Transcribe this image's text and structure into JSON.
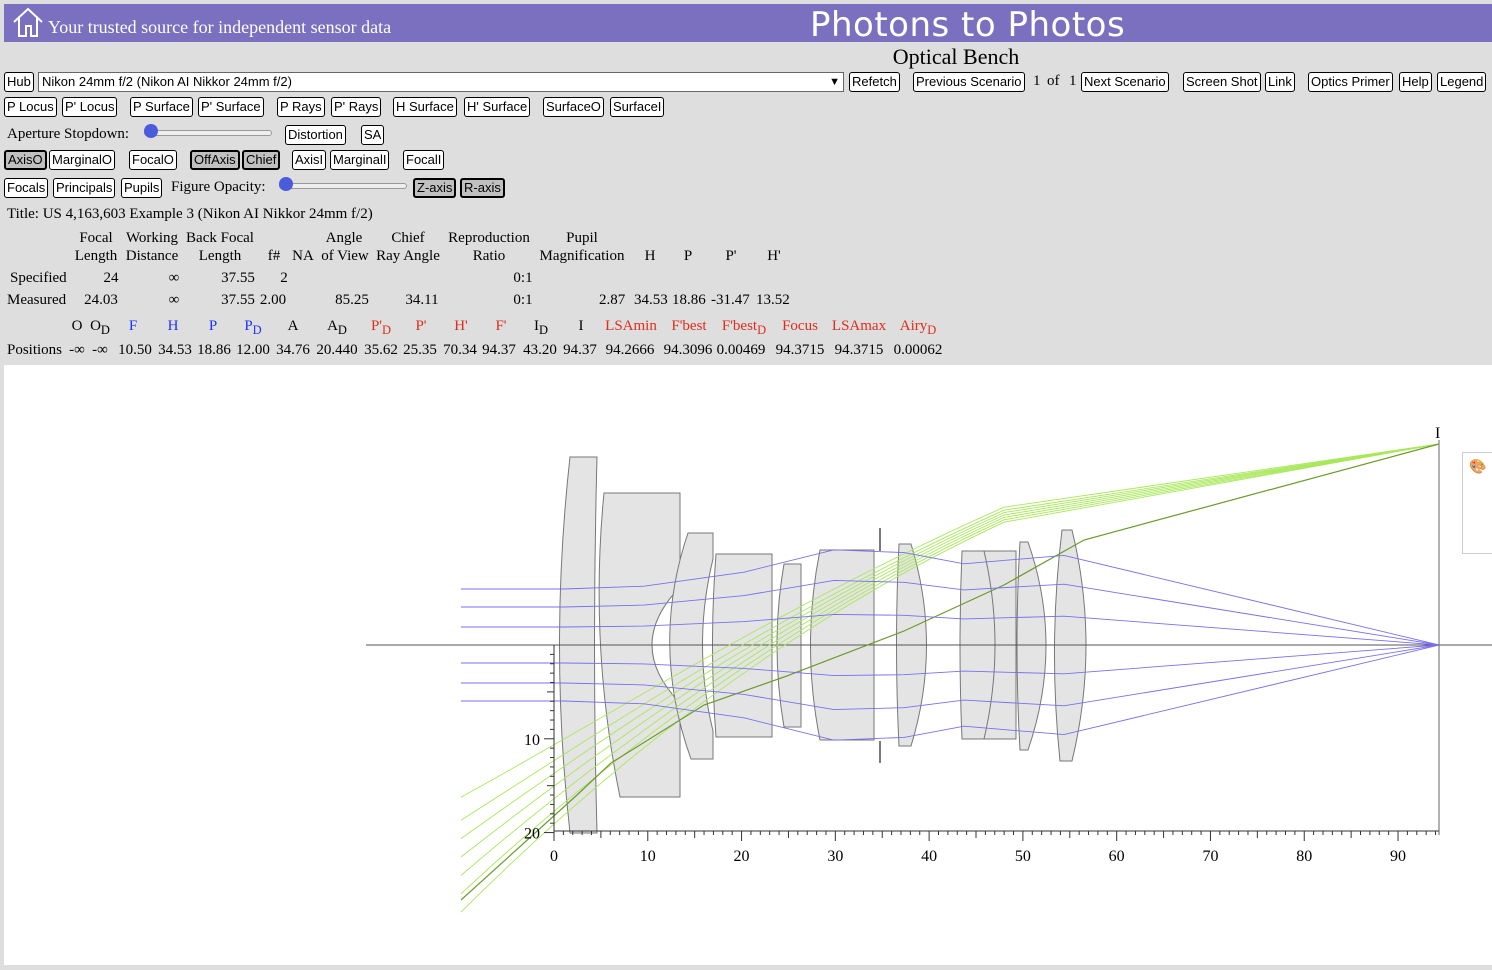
{
  "header": {
    "tagline": "Your trusted source for independent sensor data",
    "site_title": "Photons to Photos"
  },
  "page_title": "Optical Bench",
  "toolbar": {
    "hub": "Hub",
    "lens_selected": "Nikon 24mm f/2 (Nikon AI Nikkor 24mm f/2)",
    "refetch": "Refetch",
    "previous_scenario": "Previous Scenario",
    "scenario_index": "1",
    "of_label": "of",
    "scenario_count": "1",
    "next_scenario": "Next Scenario",
    "screen_shot": "Screen Shot",
    "link": "Link",
    "optics_primer": "Optics Primer",
    "help": "Help",
    "legend": "Legend"
  },
  "row2": {
    "p_locus": "P Locus",
    "pp_locus": "P' Locus",
    "p_surface": "P Surface",
    "pp_surface": "P' Surface",
    "p_rays": "P Rays",
    "pp_rays": "P' Rays",
    "h_surface": "H Surface",
    "hp_surface": "H' Surface",
    "surface_o": "SurfaceO",
    "surface_i": "SurfaceI"
  },
  "row3": {
    "aperture_label": "Aperture Stopdown:",
    "distortion": "Distortion",
    "sa": "SA"
  },
  "row4": {
    "axis_o": "AxisO",
    "marginal_o": "MarginalO",
    "focal_o": "FocalO",
    "off_axis": "OffAxis",
    "chief": "Chief",
    "axis_i": "AxisI",
    "marginal_i": "MarginalI",
    "focal_i": "FocalI"
  },
  "row5": {
    "focals": "Focals",
    "principals": "Principals",
    "pupils": "Pupils",
    "opacity_label": "Figure Opacity:",
    "z_axis": "Z-axis",
    "r_axis": "R-axis"
  },
  "lens_title": "Title: US 4,163,603 Example 3 (Nikon AI Nikkor 24mm f/2)",
  "specs_table": {
    "headers_top": [
      "Focal",
      "Working",
      "Back Focal",
      "Angle",
      "Chief",
      "Reproduction",
      "Pupil"
    ],
    "headers_bottom": [
      "Length",
      "Distance",
      "Length",
      "f#",
      "NA",
      "of View",
      "Ray Angle",
      "Ratio",
      "Magnification",
      "H",
      "P",
      "P'",
      "H'"
    ],
    "specified": {
      "label": "Specified",
      "focal": "24",
      "working": "∞",
      "bfl": "37.55",
      "fnum": "2",
      "ratio": "0:1"
    },
    "measured": {
      "label": "Measured",
      "focal": "24.03",
      "working": "∞",
      "bfl": "37.55",
      "fnum": "2.00",
      "aov": "85.25",
      "chief": "34.11",
      "ratio": "0:1",
      "pupil": "2.87",
      "h": "34.53",
      "p": "18.86",
      "pp": "-31.47",
      "hp": "13.52"
    }
  },
  "positions": {
    "label": "Positions",
    "headers": [
      {
        "t": "O",
        "c": "black"
      },
      {
        "t": "O",
        "s": "D",
        "c": "black"
      },
      {
        "t": "F",
        "c": "blue"
      },
      {
        "t": "H",
        "c": "blue"
      },
      {
        "t": "P",
        "c": "blue"
      },
      {
        "t": "P",
        "s": "D",
        "c": "blue"
      },
      {
        "t": "A",
        "c": "black"
      },
      {
        "t": "A",
        "s": "D",
        "c": "black"
      },
      {
        "t": "P'",
        "s": "D",
        "c": "red"
      },
      {
        "t": "P'",
        "c": "red"
      },
      {
        "t": "H'",
        "c": "red"
      },
      {
        "t": "F'",
        "c": "red"
      },
      {
        "t": "I",
        "s": "D",
        "c": "black"
      },
      {
        "t": "I",
        "c": "black"
      },
      {
        "t": "LSAmin",
        "c": "red"
      },
      {
        "t": "F'best",
        "c": "red"
      },
      {
        "t": "F'best",
        "s": "D",
        "c": "red"
      },
      {
        "t": "Focus",
        "c": "red"
      },
      {
        "t": "LSAmax",
        "c": "red"
      },
      {
        "t": "Airy",
        "s": "D",
        "c": "red"
      }
    ],
    "values": [
      "-∞",
      "-∞",
      "10.50",
      "34.53",
      "18.86",
      "12.00",
      "34.76",
      "20.440",
      "35.62",
      "25.35",
      "70.34",
      "94.37",
      "43.20",
      "94.37",
      "94.2666",
      "94.3096",
      "0.00469",
      "94.3715",
      "94.3715",
      "0.00062"
    ]
  },
  "diagram": {
    "x_ticks": [
      "0",
      "10",
      "20",
      "30",
      "40",
      "50",
      "60",
      "70",
      "80",
      "90"
    ],
    "y_ticks": [
      "10",
      "20"
    ],
    "image_label": "I",
    "colors": {
      "axis_rays": "#7a6ff0",
      "off_axis_rays": "#a8e85a",
      "chief_ray": "#6b9a2a",
      "lens_fill": "#e4e4e4"
    }
  }
}
